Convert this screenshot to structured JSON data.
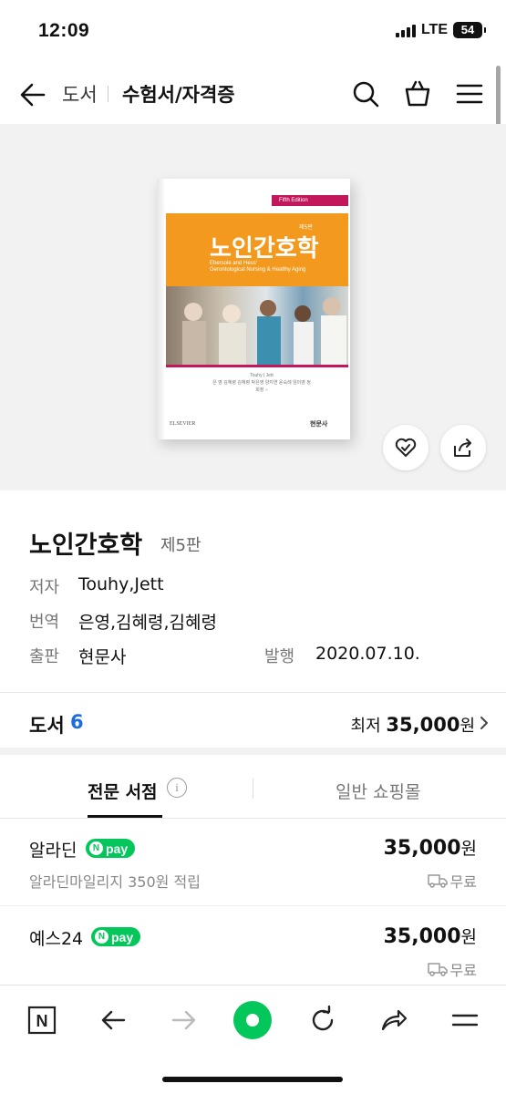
{
  "status": {
    "time": "12:09",
    "network": "LTE",
    "battery": "54"
  },
  "header": {
    "category": "도서",
    "subcategory": "수험서/자격증"
  },
  "book_cover": {
    "edition_banner": "Fifth Edition",
    "edition_small": "제5판",
    "title": "노인간호학",
    "subtitle_line1": "Ebersole and Hess'",
    "subtitle_line2": "Gerontological Nursing & Healthy Aging",
    "authors_line1": "Touhy | Jett",
    "authors_line2": "은 영 김혜령 김혜령 박은영 양지연 윤숙례 임미영 정희정 ○",
    "publisher_left": "ELSEVIER",
    "publisher_right": "현문사"
  },
  "product": {
    "title": "노인간호학",
    "edition": "제5판",
    "author_label": "저자",
    "author": "Touhy,Jett",
    "translator_label": "번역",
    "translators": "은영,김혜령,김혜령",
    "publisher_label": "출판",
    "publisher": "현문사",
    "date_label": "발행",
    "date": "2020.07.10."
  },
  "price_summary": {
    "label": "도서",
    "count": "6",
    "min_prefix": "최저",
    "min_price": "35,000",
    "currency": "원"
  },
  "tabs": [
    {
      "label": "전문 서점",
      "active": true
    },
    {
      "label": "일반 쇼핑몰",
      "active": false
    }
  ],
  "info_icon": "i",
  "stores": [
    {
      "name": "알라딘",
      "badge": "pay",
      "badge_n": "N",
      "price": "35,000",
      "currency": "원",
      "sub": "알라딘마일리지 350원 적립",
      "shipping": "무료"
    },
    {
      "name": "예스24",
      "badge": "pay",
      "badge_n": "N",
      "price": "35,000",
      "currency": "원",
      "sub": "",
      "shipping": "무료"
    }
  ],
  "toolbar": {
    "home_letter": "N"
  },
  "colors": {
    "accent_blue": "#1b6ee0",
    "naver_green": "#03c75a",
    "cover_orange": "#f39a1e",
    "cover_pink": "#c2185b"
  }
}
